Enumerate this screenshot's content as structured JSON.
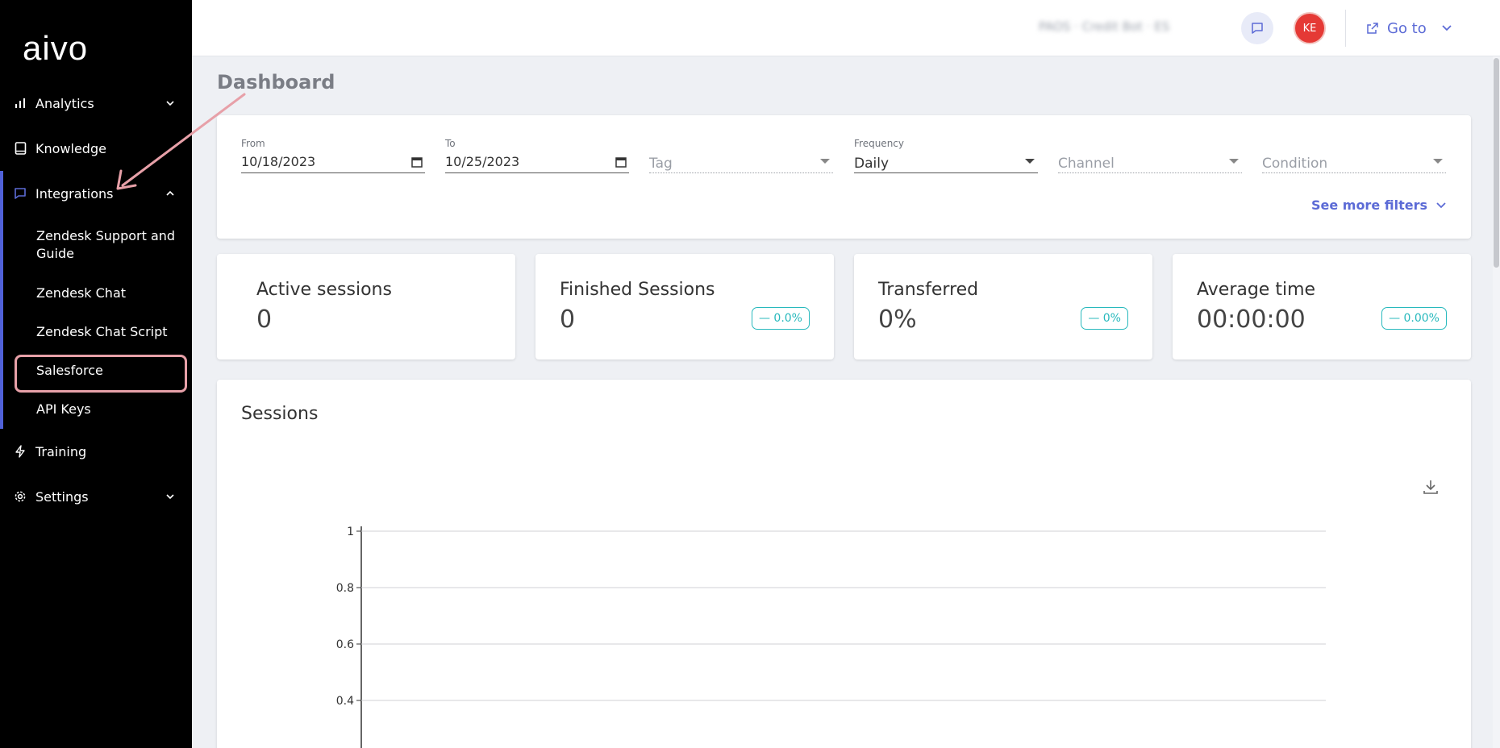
{
  "app": {
    "logo": "aivo"
  },
  "sidebar": {
    "items": [
      {
        "label": "Analytics",
        "icon": "bar-chart-icon",
        "expanded": false
      },
      {
        "label": "Knowledge",
        "icon": "book-icon",
        "expanded": false
      },
      {
        "label": "Integrations",
        "icon": "chat-bubble-icon",
        "expanded": true,
        "children": [
          "Zendesk Support and Guide",
          "Zendesk Chat",
          "Zendesk Chat Script",
          "Salesforce",
          "API Keys"
        ]
      },
      {
        "label": "Training",
        "icon": "lightning-icon"
      },
      {
        "label": "Settings",
        "icon": "gear-icon",
        "expanded": false
      }
    ],
    "highlighted_child": "Salesforce",
    "accent": "#5061d8"
  },
  "topbar": {
    "account_name": "PAOS · Credit Bot · ES",
    "avatar_initials": "KE",
    "goto_label": "Go to",
    "accent": "#5c6bd6",
    "avatar_color": "#e53935"
  },
  "page": {
    "title": "Dashboard"
  },
  "filters": {
    "from": {
      "label": "From",
      "value": "10/18/2023"
    },
    "to": {
      "label": "To",
      "value": "10/25/2023"
    },
    "tag": {
      "placeholder": "Tag"
    },
    "frequency": {
      "label": "Frequency",
      "value": "Daily"
    },
    "channel": {
      "placeholder": "Channel"
    },
    "condition": {
      "placeholder": "Condition"
    },
    "more_label": "See more filters"
  },
  "stats": [
    {
      "label": "Active sessions",
      "value": "0"
    },
    {
      "label": "Finished Sessions",
      "value": "0",
      "badge": "— 0.0%"
    },
    {
      "label": "Transferred",
      "value": "0%",
      "badge": "— 0%"
    },
    {
      "label": "Average time",
      "value": "00:00:00",
      "badge": "— 0.00%"
    }
  ],
  "sessions": {
    "title": "Sessions",
    "chart_data": {
      "type": "line",
      "title": "",
      "xlabel": "",
      "ylabel": "",
      "y_ticks": [
        "1",
        "0.8",
        "0.6",
        "0.4"
      ],
      "ylim": [
        0,
        1
      ],
      "series": [],
      "grid": true
    }
  }
}
